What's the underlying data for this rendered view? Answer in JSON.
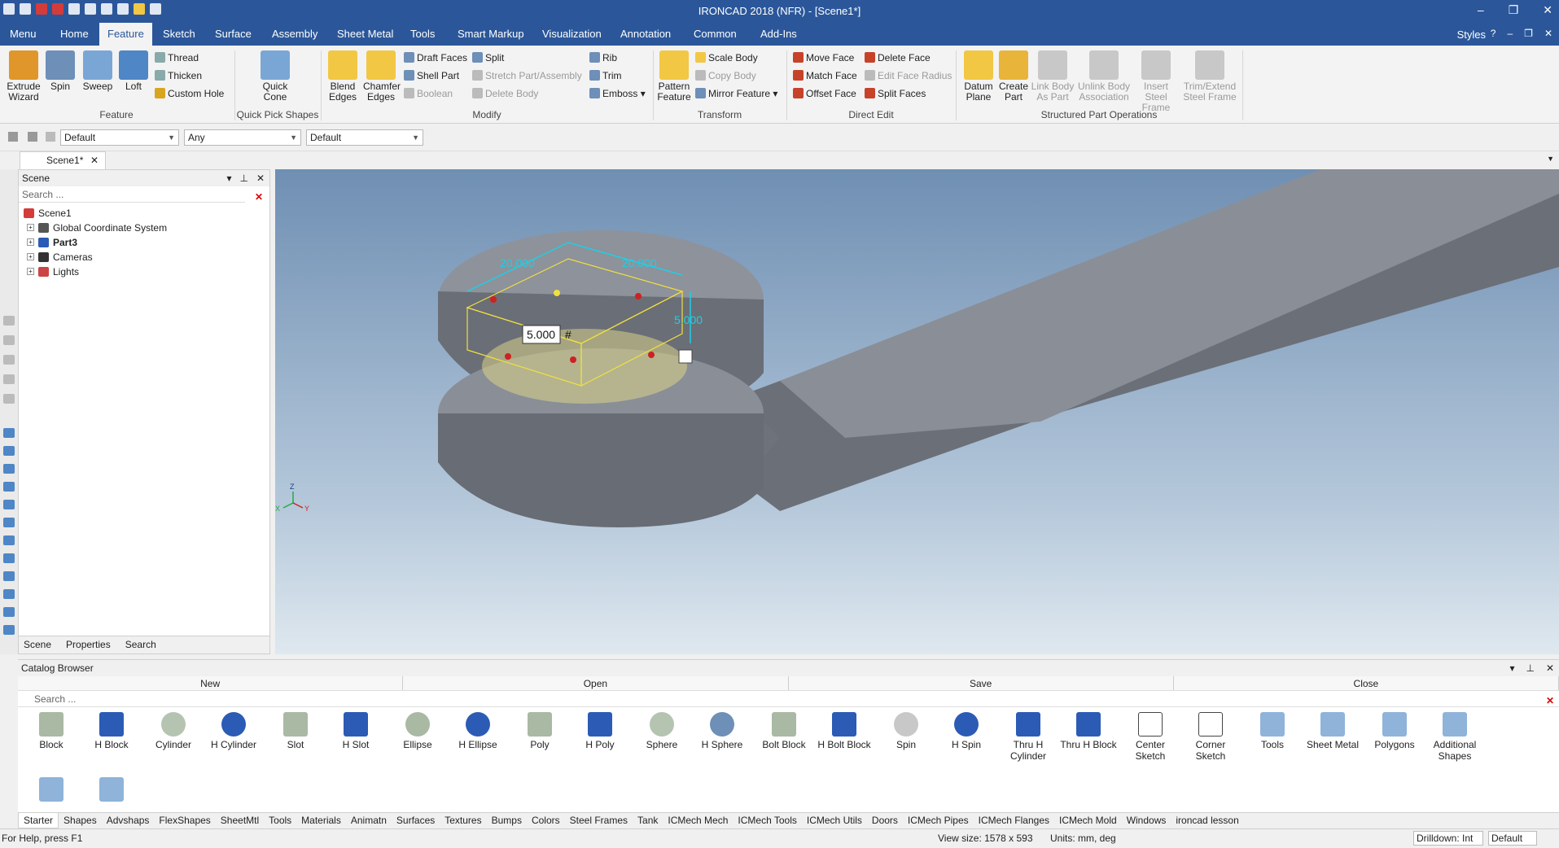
{
  "window": {
    "title": "IRONCAD 2018 (NFR) - [Scene1*]"
  },
  "menubar": {
    "tabs": [
      "Menu",
      "Home",
      "Feature",
      "Sketch",
      "Surface",
      "Assembly",
      "Sheet Metal",
      "Tools",
      "Smart Markup",
      "Visualization",
      "Annotation",
      "Common",
      "Add-Ins"
    ],
    "active": "Feature",
    "styles_label": "Styles"
  },
  "ribbon": {
    "extrude_wizard": "Extrude Wizard",
    "spin": "Spin",
    "sweep": "Sweep",
    "loft": "Loft",
    "thread": "Thread",
    "thicken": "Thicken",
    "custom_hole": "Custom Hole",
    "group_feature": "Feature",
    "quick_cone": "Quick Cone",
    "group_quick_pick": "Quick Pick Shapes",
    "blend_edges": "Blend Edges",
    "chamfer_edges": "Chamfer Edges",
    "draft_faces": "Draft Faces",
    "shell_part": "Shell Part",
    "boolean": "Boolean",
    "split": "Split",
    "stretch_part": "Stretch Part/Assembly",
    "delete_body": "Delete Body",
    "rib": "Rib",
    "trim": "Trim",
    "emboss": "Emboss",
    "group_modify": "Modify",
    "pattern_feature": "Pattern Feature",
    "scale_body": "Scale Body",
    "copy_body": "Copy Body",
    "mirror_feature": "Mirror Feature",
    "group_transform": "Transform",
    "move_face": "Move Face",
    "match_face": "Match Face",
    "offset_face": "Offset Face",
    "delete_face": "Delete Face",
    "edit_face_radius": "Edit Face Radius",
    "split_faces": "Split Faces",
    "group_direct_edit": "Direct Edit",
    "datum_plane": "Datum Plane",
    "create_part": "Create Part",
    "link_body": "Link Body As Part",
    "unlink_body": "Unlink Body Association",
    "insert_steel": "Insert Steel Frame",
    "trim_extend_steel": "Trim/Extend Steel Frame",
    "group_structured": "Structured Part Operations"
  },
  "toolbar2": {
    "combo1": "Default",
    "combo2": "Any",
    "combo3": "Default"
  },
  "doc_tab": "Scene1*",
  "scene_panel": {
    "title": "Scene",
    "search_placeholder": "Search ...",
    "tree": [
      {
        "label": "Scene1",
        "level": 0
      },
      {
        "label": "Global Coordinate System",
        "level": 1
      },
      {
        "label": "Part3",
        "level": 1
      },
      {
        "label": "Cameras",
        "level": 1
      },
      {
        "label": "Lights",
        "level": 1
      }
    ],
    "tabs": [
      "Scene",
      "Properties",
      "Search"
    ]
  },
  "viewport": {
    "dim_left": "20.000",
    "dim_right": "20.000",
    "dim_height": "5.000",
    "input_value": "5.000",
    "input_hash": "#",
    "axis_z": "Z",
    "axis_x": "X",
    "axis_y": "Y"
  },
  "catalog": {
    "title": "Catalog Browser",
    "actions": [
      "New",
      "Open",
      "Save",
      "Close"
    ],
    "search_placeholder": "Search ...",
    "shapes": [
      "Block",
      "H Block",
      "Cylinder",
      "H Cylinder",
      "Slot",
      "H Slot",
      "Ellipse",
      "H Ellipse",
      "Poly",
      "H Poly",
      "Sphere",
      "H Sphere",
      "Bolt Block",
      "H Bolt Block",
      "Spin",
      "H Spin",
      "Thru H Cylinder",
      "Thru H Block",
      "Center Sketch",
      "Corner Sketch",
      "Tools",
      "Sheet Metal",
      "Polygons",
      "Additional Shapes"
    ],
    "tabs": [
      "Starter",
      "Shapes",
      "Advshaps",
      "FlexShapes",
      "SheetMtl",
      "Tools",
      "Materials",
      "Animatn",
      "Surfaces",
      "Textures",
      "Bumps",
      "Colors",
      "Steel Frames",
      "Tank",
      "ICMech Mech",
      "ICMech Tools",
      "ICMech Utils",
      "Doors",
      "ICMech Pipes",
      "ICMech Flanges",
      "ICMech Mold",
      "Windows",
      "ironcad lesson"
    ]
  },
  "status": {
    "help": "For Help, press F1",
    "view_size": "View size: 1578 x 593",
    "units": "Units: mm, deg",
    "drilldown": "Drilldown: Int",
    "default": "Default"
  }
}
